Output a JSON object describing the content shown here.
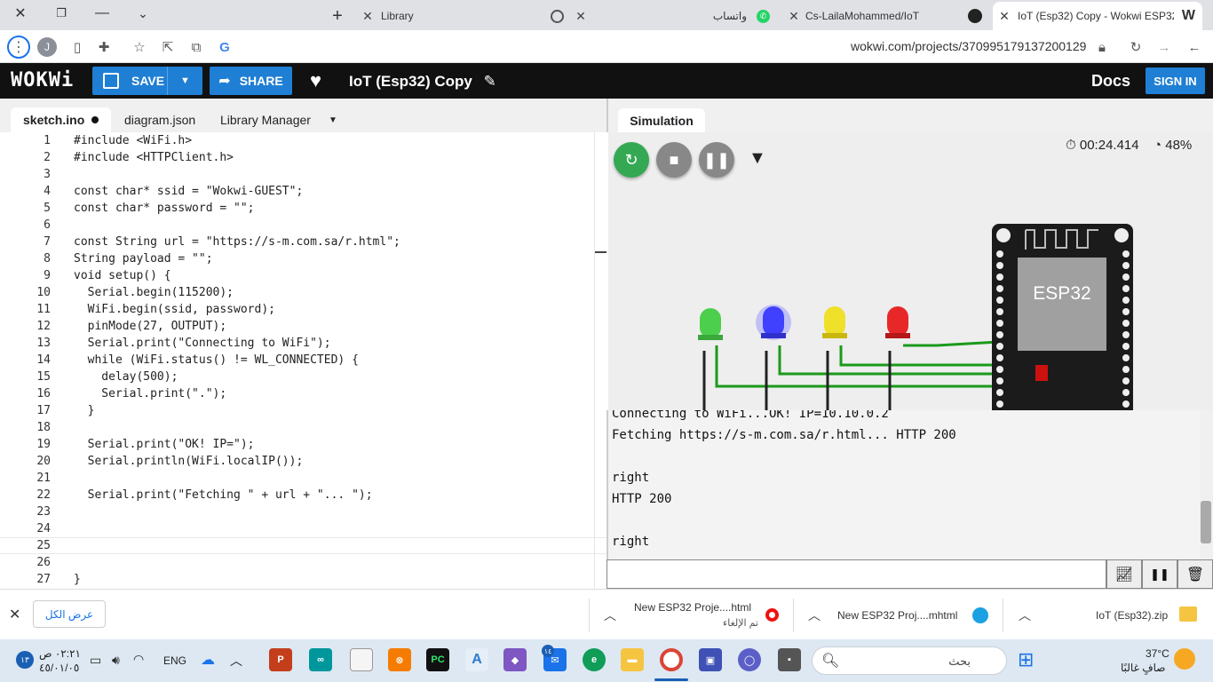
{
  "browser": {
    "tabs": [
      {
        "title": "Library"
      },
      {
        "title": "واتساب"
      },
      {
        "title": "Cs-LailaMohammed/IoT"
      },
      {
        "title": "IoT (Esp32) Copy - Wokwi ESP32"
      }
    ],
    "new_tab": "+",
    "url": "wokwi.com/projects/370995179137200129",
    "profile_initial": "J"
  },
  "wokwi": {
    "logo": "WOKWi",
    "save_label": "SAVE",
    "share_label": "SHARE",
    "project_title": "IoT (Esp32) Copy",
    "docs_label": "Docs",
    "signin_label": "SIGN IN"
  },
  "editor": {
    "tabs": [
      "sketch.ino",
      "diagram.json",
      "Library Manager"
    ],
    "line_numbers": [
      "1",
      "2",
      "3",
      "4",
      "5",
      "6",
      "7",
      "8",
      "9",
      "10",
      "11",
      "12",
      "13",
      "14",
      "15",
      "16",
      "17",
      "18",
      "19",
      "20",
      "21",
      "22",
      "23",
      "24",
      "25",
      "26",
      "27"
    ],
    "lines": [
      "#include <WiFi.h>",
      "#include <HTTPClient.h>",
      "",
      "const char* ssid = \"Wokwi-GUEST\";",
      "const char* password = \"\";",
      "",
      "const String url = \"https://s-m.com.sa/r.html\";",
      "String payload = \"\";",
      "void setup() {",
      "  Serial.begin(115200);",
      "  WiFi.begin(ssid, password);",
      "  pinMode(27, OUTPUT);",
      "  Serial.print(\"Connecting to WiFi\");",
      "  while (WiFi.status() != WL_CONNECTED) {",
      "    delay(500);",
      "    Serial.print(\".\");",
      "  }",
      "",
      "  Serial.print(\"OK! IP=\");",
      "  Serial.println(WiFi.localIP());",
      "",
      "  Serial.print(\"Fetching \" + url + \"... \");",
      "",
      "",
      "",
      "",
      "}"
    ]
  },
  "simulation": {
    "tab_label": "Simulation",
    "timer": "00:24.414",
    "cpu": "48%",
    "chip_label": "ESP32",
    "leds": [
      {
        "color": "#3fbf3f"
      },
      {
        "color": "#3a3aff"
      },
      {
        "color": "#e8d81a"
      },
      {
        "color": "#e02020"
      }
    ],
    "serial_lines": [
      "Connecting to WiFi...OK! IP=10.10.0.2",
      "Fetching https://s-m.com.sa/r.html... HTTP 200",
      "",
      "right",
      "HTTP 200",
      "",
      "right"
    ]
  },
  "downloads": {
    "show_all": "عرض الكل",
    "items": [
      {
        "name": "New ESP32 Proje....html",
        "status": "تم الإلغاء"
      },
      {
        "name": "New ESP32 Proj....mhtml",
        "status": ""
      },
      {
        "name": "IoT (Esp32).zip",
        "status": ""
      }
    ]
  },
  "taskbar": {
    "weather_temp": "37°C",
    "weather_desc": "صافٍ غالبًا",
    "search_placeholder": "بحث",
    "language": "ENG",
    "time": "٠٢:٢١ ص",
    "date": "٤٥/٠١/٠٥",
    "notif_count": "١٣",
    "mail_badge": "١٤"
  }
}
